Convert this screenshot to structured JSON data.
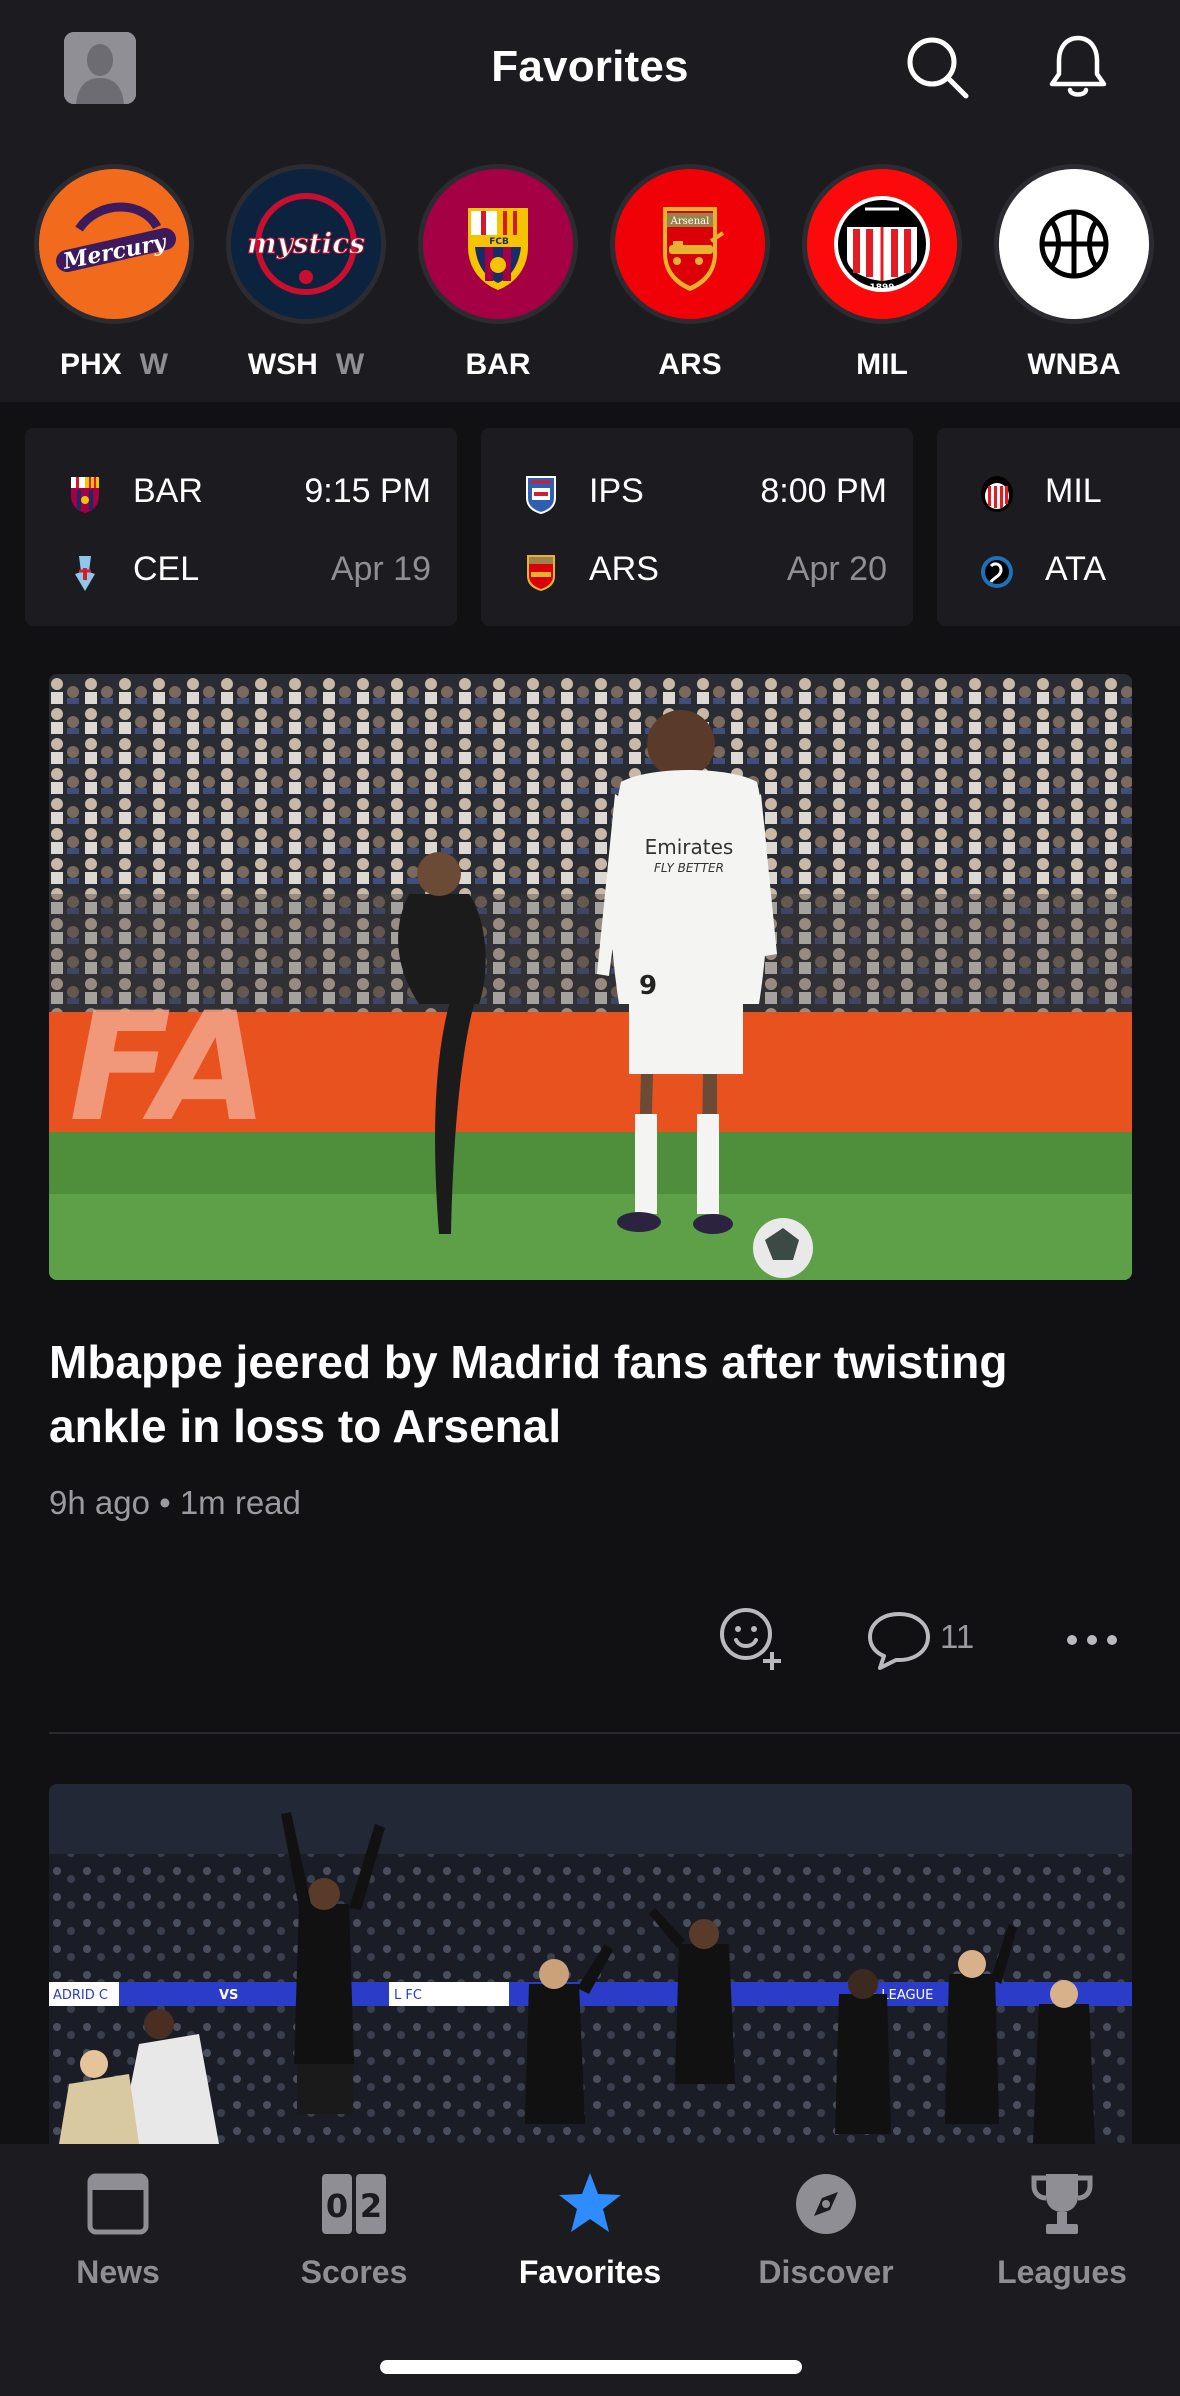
{
  "header": {
    "title": "Favorites",
    "avatar_icon": "user-avatar-icon",
    "search_icon": "search-icon",
    "notifications_icon": "bell-icon"
  },
  "favorites": [
    {
      "abbr": "PHX",
      "suffix": "W",
      "logo_text": "Mercury",
      "color": "#f26b1d"
    },
    {
      "abbr": "WSH",
      "suffix": "W",
      "logo_text": "mystics",
      "color": "#0c2340"
    },
    {
      "abbr": "BAR",
      "suffix": "",
      "logo_text": "FCB",
      "color": "#a50044"
    },
    {
      "abbr": "ARS",
      "suffix": "",
      "logo_text": "Arsenal",
      "color": "#ef0107"
    },
    {
      "abbr": "MIL",
      "suffix": "",
      "logo_text": "1899",
      "color": "#fb090b"
    },
    {
      "abbr": "WNBA",
      "suffix": "",
      "logo_text": "",
      "color": "#ffffff"
    }
  ],
  "scores": [
    {
      "home": "BAR",
      "away": "CEL",
      "time": "9:15 PM",
      "date": "Apr 19"
    },
    {
      "home": "IPS",
      "away": "ARS",
      "time": "8:00 PM",
      "date": "Apr 20"
    },
    {
      "home": "MIL",
      "away": "ATA",
      "time": "",
      "date": ""
    }
  ],
  "articles": [
    {
      "headline": "Mbappe jeered by Madrid fans after twisting ankle in loss to Arsenal",
      "age": "9h ago",
      "read_time": "1m read",
      "byline": "9h ago • 1m read",
      "comment_count": "11",
      "image_text": {
        "jersey_sponsor": "Emirates",
        "jersey_sub": "FLY BETTER",
        "jersey_number": "9",
        "board": "FA"
      }
    },
    {
      "image_text": {
        "board_left": "ADRID C",
        "board_vs": "VS",
        "board_mid": "L FC",
        "board_right": "S LEAGUE"
      }
    }
  ],
  "tabbar": {
    "tabs": [
      {
        "label": "News",
        "icon": "newspaper-icon",
        "active": false
      },
      {
        "label": "Scores",
        "icon": "scoreboard-icon",
        "active": false,
        "digits": [
          "0",
          "2"
        ]
      },
      {
        "label": "Favorites",
        "icon": "star-icon",
        "active": true
      },
      {
        "label": "Discover",
        "icon": "compass-icon",
        "active": false
      },
      {
        "label": "Leagues",
        "icon": "trophy-icon",
        "active": false
      }
    ]
  },
  "colors": {
    "background": "#111013",
    "surface": "#1c1b1f",
    "accent": "#2f8cff",
    "muted_text": "#8e8e94"
  }
}
